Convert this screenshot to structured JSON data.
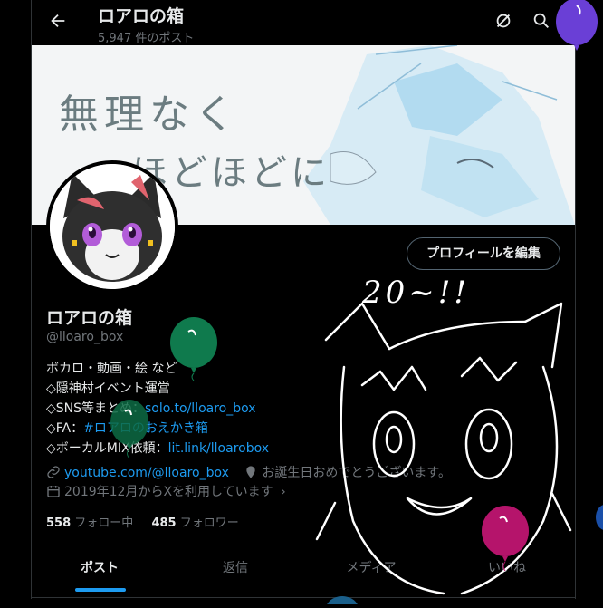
{
  "header": {
    "title": "ロアロの箱",
    "post_count": "5,947 件のポスト"
  },
  "profile": {
    "name": "ロアロの箱",
    "handle": "@lloaro_box",
    "edit_button": "プロフィールを編集",
    "bio": {
      "line1": "ボカロ・動画・絵 など",
      "line2": "◇隠神村イベント運営",
      "line3_prefix": "◇SNS等まとめ：",
      "line3_link": "solo.to/lloaro_box",
      "line4_prefix": "◇FA：",
      "line4_link": "#ロアロのおえかき箱",
      "line5_prefix": "◇ボーカルMIX依頼：",
      "line5_link": "lit.link/lloarobox"
    },
    "website": "youtube.com/@lloaro_box",
    "birthday": "お誕生日おめでとうございます。",
    "joined": "2019年12月からXを利用しています",
    "following_count": "558",
    "following_label": "フォロー中",
    "followers_count": "485",
    "followers_label": "フォロワー"
  },
  "banner": {
    "text_line1": "無理なく",
    "text_line2": "ほどほどに"
  },
  "doodle_text": "20~!!",
  "tabs": [
    {
      "label": "ポスト",
      "active": true
    },
    {
      "label": "返信",
      "active": false
    },
    {
      "label": "メディア",
      "active": false
    },
    {
      "label": "いいね",
      "active": false
    }
  ],
  "colors": {
    "accent": "#1d9bf0",
    "background": "#000000",
    "muted": "#71767b",
    "balloon_purple": "#6a3fd6",
    "balloon_green": "#0f7a4d",
    "balloon_magenta": "#b5146b"
  }
}
